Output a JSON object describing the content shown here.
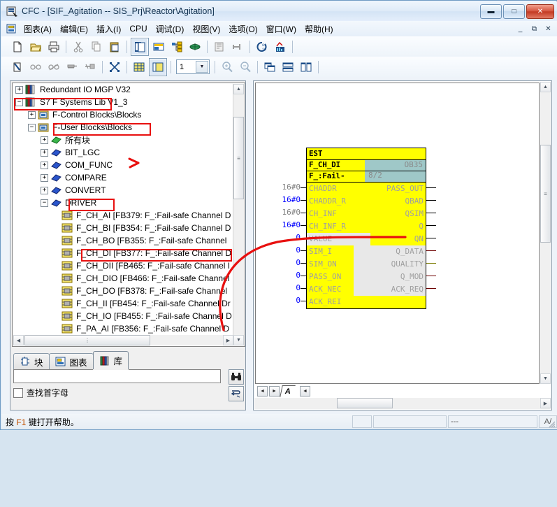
{
  "window": {
    "title": "CFC - [SIF_Agitation -- SIS_Prj\\Reactor\\Agitation]",
    "app_icon": "cfc-app-icon",
    "controls": {
      "minimize": "—",
      "maximize": "□",
      "close": "✕"
    },
    "mdi_controls": {
      "minimize": "_",
      "restore": "⧉",
      "close": "✕"
    }
  },
  "menu": {
    "doc_icon": "chart-doc-icon",
    "items": [
      {
        "label": "图表(A)",
        "name": "menu-chart"
      },
      {
        "label": "编辑(E)",
        "name": "menu-edit"
      },
      {
        "label": "插入(I)",
        "name": "menu-insert"
      },
      {
        "label": "CPU",
        "name": "menu-cpu"
      },
      {
        "label": "调试(D)",
        "name": "menu-debug"
      },
      {
        "label": "视图(V)",
        "name": "menu-view"
      },
      {
        "label": "选项(O)",
        "name": "menu-options"
      },
      {
        "label": "窗口(W)",
        "name": "menu-window"
      },
      {
        "label": "帮助(H)",
        "name": "menu-help"
      }
    ]
  },
  "toolbar1": {
    "buttons": [
      {
        "name": "new-icon",
        "icon": "new-document"
      },
      {
        "name": "open-icon",
        "icon": "open-folder"
      },
      {
        "name": "print-icon",
        "icon": "printer"
      },
      {
        "name": "cut-icon",
        "icon": "scissors"
      },
      {
        "name": "copy-icon",
        "icon": "copy-pages"
      },
      {
        "name": "paste-icon",
        "icon": "clipboard"
      },
      {
        "name": "chart-view-icon",
        "icon": "chart-window",
        "pressed": true
      },
      {
        "name": "sheet-view-icon",
        "icon": "sheet-window"
      },
      {
        "name": "overview-icon",
        "icon": "tree-overview"
      },
      {
        "name": "runtime-groups-icon",
        "icon": "runtime-group"
      },
      {
        "name": "compile-icon",
        "icon": "compile"
      },
      {
        "name": "download-icon",
        "icon": "download-arrow"
      },
      {
        "name": "test-mode-icon",
        "icon": "test-mode"
      },
      {
        "name": "statistics-icon",
        "icon": "statistics"
      }
    ]
  },
  "toolbar2": {
    "zoom_value": "1",
    "buttons": [
      {
        "name": "open-block-icon",
        "icon": "open-block"
      },
      {
        "name": "watch-icon",
        "icon": "glasses"
      },
      {
        "name": "cross-out-icon",
        "icon": "crossed-glasses"
      },
      {
        "name": "insert-input-icon",
        "icon": "input-bar"
      },
      {
        "name": "insert-connector-icon",
        "icon": "connector"
      },
      {
        "name": "fit-icon",
        "icon": "fit-to-window"
      },
      {
        "name": "grid-icon",
        "icon": "grid-table"
      },
      {
        "name": "sheet-grid-icon",
        "icon": "sheet-grid",
        "pressed": true
      },
      {
        "name": "zoom-in-icon",
        "icon": "zoom-in"
      },
      {
        "name": "zoom-out-icon",
        "icon": "zoom-out"
      },
      {
        "name": "cascade-icon",
        "icon": "cascade-windows"
      },
      {
        "name": "tile-horizontal-icon",
        "icon": "tile-horizontal"
      },
      {
        "name": "tile-vertical-icon",
        "icon": "tile-vertical"
      }
    ]
  },
  "catalog": {
    "tree": [
      {
        "label": "Redundant IO MGP V32",
        "indent": 0,
        "expander": "+",
        "icon": "library-books-icon",
        "name": "tree-item-redundant-io"
      },
      {
        "label": "S7 F Systems Lib V1_3",
        "indent": 0,
        "expander": "−",
        "icon": "library-books-icon",
        "name": "tree-item-s7-f-systems-lib",
        "highlight": true
      },
      {
        "label": "F-Control Blocks\\Blocks",
        "indent": 1,
        "expander": "+",
        "icon": "folder-blocks-icon",
        "name": "tree-item-f-control-blocks"
      },
      {
        "label": "F-User Blocks\\Blocks",
        "indent": 1,
        "expander": "−",
        "icon": "folder-blocks-icon",
        "name": "tree-item-f-user-blocks",
        "highlight": true
      },
      {
        "label": "所有块",
        "indent": 2,
        "expander": "+",
        "icon": "green-family-icon",
        "name": "tree-item-all-blocks"
      },
      {
        "label": "BIT_LGC",
        "indent": 2,
        "expander": "+",
        "icon": "blue-family-icon",
        "name": "tree-item-bit-lgc"
      },
      {
        "label": "COM_FUNC",
        "indent": 2,
        "expander": "+",
        "icon": "blue-family-icon",
        "name": "tree-item-com-func"
      },
      {
        "label": "COMPARE",
        "indent": 2,
        "expander": "+",
        "icon": "blue-family-icon",
        "name": "tree-item-compare"
      },
      {
        "label": "CONVERT",
        "indent": 2,
        "expander": "+",
        "icon": "blue-family-icon",
        "name": "tree-item-convert"
      },
      {
        "label": "DRIVER",
        "indent": 2,
        "expander": "−",
        "icon": "blue-family-icon",
        "name": "tree-item-driver",
        "highlight": true
      },
      {
        "label": "F_CH_AI  [FB379: F_:Fail-safe Channel D",
        "indent": 3,
        "expander": "",
        "icon": "fb-block-icon",
        "name": "tree-item-f-ch-ai"
      },
      {
        "label": "F_CH_BI  [FB354: F_:Fail-safe Channel D",
        "indent": 3,
        "expander": "",
        "icon": "fb-block-icon",
        "name": "tree-item-f-ch-bi"
      },
      {
        "label": "F_CH_BO  [FB355: F_:Fail-safe Channel",
        "indent": 3,
        "expander": "",
        "icon": "fb-block-icon",
        "name": "tree-item-f-ch-bo"
      },
      {
        "label": "F_CH_DI  [FB377: F_:Fail-safe Channel D",
        "indent": 3,
        "expander": "",
        "icon": "fb-block-icon",
        "name": "tree-item-f-ch-di",
        "highlight": true
      },
      {
        "label": "F_CH_DII  [FB465: F_:Fail-safe Channel I",
        "indent": 3,
        "expander": "",
        "icon": "fb-block-icon",
        "name": "tree-item-f-ch-dii"
      },
      {
        "label": "F_CH_DIO  [FB466: F_:Fail-safe Channel",
        "indent": 3,
        "expander": "",
        "icon": "fb-block-icon",
        "name": "tree-item-f-ch-dio"
      },
      {
        "label": "F_CH_DO  [FB378: F_:Fail-safe Channel",
        "indent": 3,
        "expander": "",
        "icon": "fb-block-icon",
        "name": "tree-item-f-ch-do"
      },
      {
        "label": "F_CH_II  [FB454: F_:Fail-safe Channel Dr",
        "indent": 3,
        "expander": "",
        "icon": "fb-block-icon",
        "name": "tree-item-f-ch-ii"
      },
      {
        "label": "F_CH_IO  [FB455: F_:Fail-safe Channel D",
        "indent": 3,
        "expander": "",
        "icon": "fb-block-icon",
        "name": "tree-item-f-ch-io"
      },
      {
        "label": "F_PA_AI  [FB356: F_:Fail-safe Channel D",
        "indent": 3,
        "expander": "",
        "icon": "fb-block-icon",
        "name": "tree-item-f-pa-ai"
      }
    ],
    "tabs": [
      {
        "label": "块",
        "icon": "block-tab-icon",
        "name": "tab-blocks",
        "active": false
      },
      {
        "label": "图表",
        "icon": "chart-tab-icon",
        "name": "tab-charts",
        "active": false
      },
      {
        "label": "库",
        "icon": "library-tab-icon",
        "name": "tab-libraries",
        "active": true
      }
    ],
    "search": {
      "value": "",
      "placeholder": ""
    },
    "find_icon": "binoculars-icon",
    "jump_icon": "jump-to-icon",
    "checkbox": {
      "label": "查找首字母",
      "checked": false
    }
  },
  "diagram": {
    "block": {
      "comment": "EST",
      "type_name": "F_CH_DI",
      "family": "F_:Fail-",
      "ob_label": "OB35",
      "ob_position": "8/2",
      "inputs": [
        {
          "name": "CHADDR",
          "value": "16#0",
          "value_color": "#808080"
        },
        {
          "name": "CHADDR_R",
          "value": "16#0",
          "value_color": "#0000ff"
        },
        {
          "name": "CH_INF",
          "value": "16#0",
          "value_color": "#808080"
        },
        {
          "name": "CH_INF_R",
          "value": "16#0",
          "value_color": "#0000ff"
        },
        {
          "name": "VALUE",
          "value": "0",
          "value_color": "#0000ff",
          "shaded": true
        },
        {
          "name": "SIM_I",
          "value": "0",
          "value_color": "#0000ff"
        },
        {
          "name": "SIM_ON",
          "value": "0",
          "value_color": "#0000ff"
        },
        {
          "name": "PASS_ON",
          "value": "0",
          "value_color": "#0000ff"
        },
        {
          "name": "ACK_NEC",
          "value": "0",
          "value_color": "#0000ff"
        },
        {
          "name": "ACK_REI",
          "value": "0",
          "value_color": "#0000ff"
        }
      ],
      "outputs": [
        {
          "name": "PASS_OUT",
          "shaded": false
        },
        {
          "name": "QBAD",
          "shaded": false
        },
        {
          "name": "QSIM",
          "shaded": false
        },
        {
          "name": "Q",
          "shaded": false
        },
        {
          "name": "QN",
          "shaded": false
        },
        {
          "name": "Q_DATA",
          "shaded": true
        },
        {
          "name": "QUALITY",
          "shaded": true
        },
        {
          "name": "Q_MOD",
          "shaded": true
        },
        {
          "name": "ACK_REQ",
          "shaded": true
        }
      ]
    },
    "sheet_tab": "A",
    "nav": {
      "prev": "◄",
      "next": "►",
      "page_prev": "◄"
    }
  },
  "status": {
    "message_pre": "按 ",
    "message_key": "F1",
    "message_post": " 键打开帮助。",
    "panel_dash": "---",
    "panel_az": "A/"
  },
  "colors": {
    "block_fill": "#ffff00",
    "block_header_badge": "#9fc8c8",
    "annotation": "#e8100f",
    "pin_text": "#a0a0a0"
  }
}
